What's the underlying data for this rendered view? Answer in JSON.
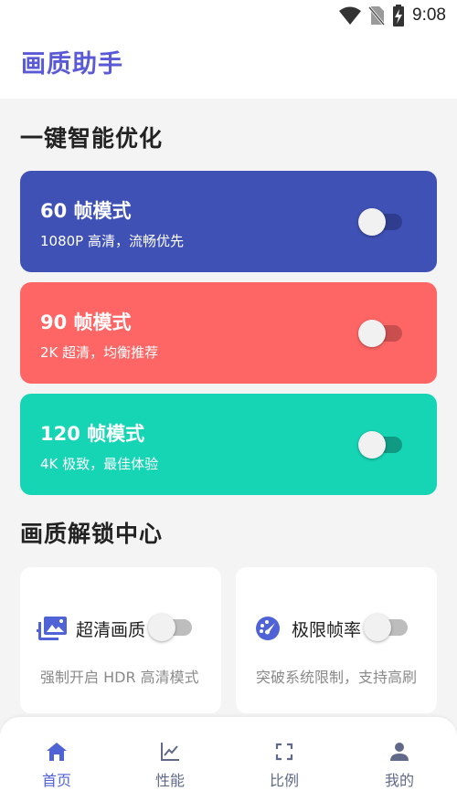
{
  "status": {
    "time": "9:08"
  },
  "app": {
    "title": "画质助手"
  },
  "sections": {
    "smart": "一键智能优化",
    "unlock": "画质解锁中心"
  },
  "modes": [
    {
      "title": "60 帧模式",
      "subtitle": "1080P 高清，流畅优先",
      "bg": "#3f51b5",
      "track": "#2f3d8f",
      "on": false
    },
    {
      "title": "90 帧模式",
      "subtitle": "2K 超清，均衡推荐",
      "bg": "#fe6665",
      "track": "#c94f4f",
      "on": false
    },
    {
      "title": "120 帧模式",
      "subtitle": "4K 极致，最佳体验",
      "bg": "#16d5b5",
      "track": "#119a83",
      "on": false
    }
  ],
  "features": [
    {
      "title": "超清画质",
      "desc": "强制开启 HDR 高清模式",
      "icon": "photo-library-icon",
      "on": false
    },
    {
      "title": "极限帧率",
      "desc": "突破系统限制，支持高刷",
      "icon": "speedometer-icon",
      "on": false
    }
  ],
  "nav": [
    {
      "label": "首页",
      "icon": "home-icon",
      "active": true
    },
    {
      "label": "性能",
      "icon": "chart-icon",
      "active": false
    },
    {
      "label": "比例",
      "icon": "fullscreen-icon",
      "active": false
    },
    {
      "label": "我的",
      "icon": "person-icon",
      "active": false
    }
  ],
  "colors": {
    "accent": "#5a5ad6",
    "nav_active": "#4f62d6",
    "nav_inactive": "#606a88",
    "toggle_off_track": "#bdbdbd"
  }
}
